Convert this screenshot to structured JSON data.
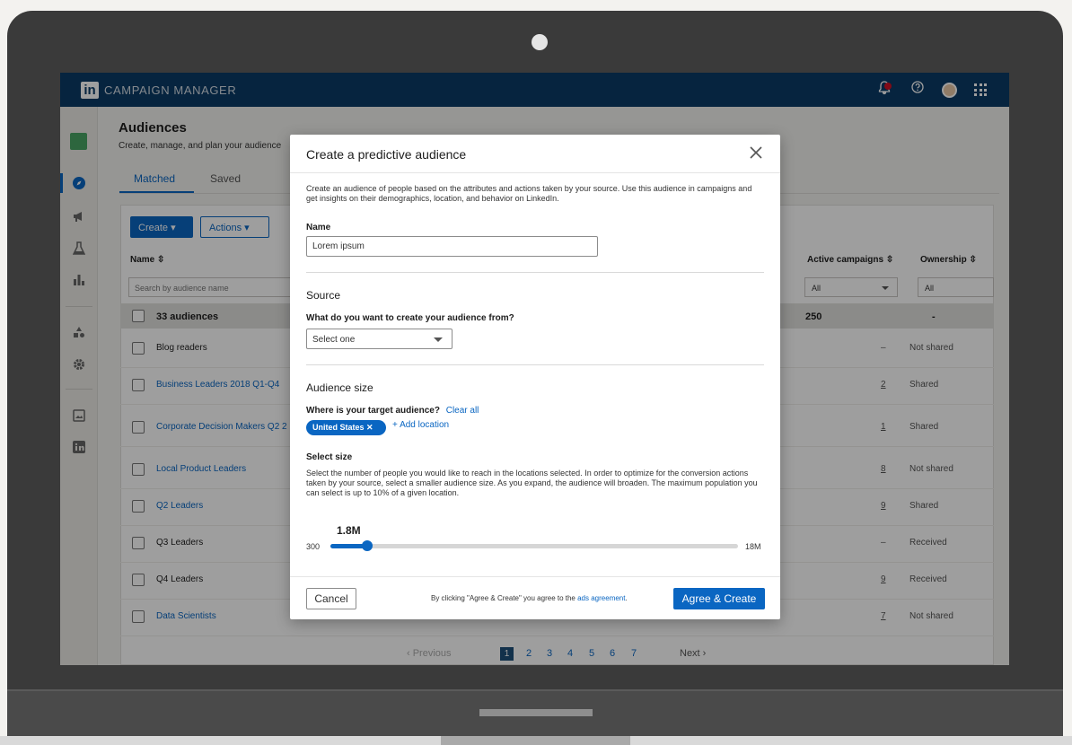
{
  "app": {
    "title": "CAMPAIGN MANAGER",
    "logo": "in"
  },
  "topbar": {
    "icons": [
      "bell-icon",
      "help-icon",
      "avatar",
      "apps-grid-icon"
    ]
  },
  "page": {
    "title": "Audiences",
    "subtitle": "Create, manage, and plan your audience",
    "tabs": [
      {
        "label": "Matched"
      },
      {
        "label": "Saved"
      }
    ]
  },
  "toolbar": {
    "create_label": "Create ▾",
    "actions_label": "Actions ▾"
  },
  "table": {
    "columns": {
      "name": "Name ⇳",
      "active": "Active campaigns ⇳",
      "ownership": "Ownership ⇳"
    },
    "search_placeholder": "Search by audience name",
    "filter_active": "All",
    "filter_ownership": "All",
    "summary": {
      "label": "33 audiences",
      "count": "250",
      "ownership": "-"
    },
    "rows": [
      {
        "name": "Blog readers",
        "count": "–",
        "ownership": "Not shared",
        "link": false
      },
      {
        "name": "Business Leaders 2018 Q1-Q4",
        "count": "2",
        "ownership": "Shared",
        "link": true
      },
      {
        "name": "Corporate Decision Makers Q2 2",
        "count": "1",
        "ownership": "Shared",
        "link": true
      },
      {
        "name": "Local Product Leaders",
        "count": "8",
        "ownership": "Not shared",
        "link": true
      },
      {
        "name": "Q2 Leaders",
        "count": "9",
        "ownership": "Shared",
        "link": true
      },
      {
        "name": "Q3 Leaders",
        "count": "–",
        "ownership": "Received",
        "link": false
      },
      {
        "name": "Q4 Leaders",
        "count": "9",
        "ownership": "Received",
        "link": false
      },
      {
        "name": "Data Scientists",
        "count": "7",
        "ownership": "Not shared",
        "link": true
      }
    ]
  },
  "pagination": {
    "previous": "‹ Previous",
    "pages": [
      "1",
      "2",
      "3",
      "4",
      "5",
      "6",
      "7"
    ],
    "next": "Next ›"
  },
  "modal": {
    "title": "Create a predictive audience",
    "description": "Create an audience of people based on the attributes and actions taken by your source. Use this audience in campaigns and get insights on their demographics, location, and behavior on LinkedIn.",
    "name_label": "Name",
    "name_value": "Lorem ipsum",
    "source_heading": "Source",
    "source_question": "What do you want to create your audience from?",
    "source_select": "Select one",
    "size_heading": "Audience size",
    "target_question": "Where is your target audience?",
    "clear_all": "Clear all",
    "location_chip": "United States ✕",
    "add_location": "+ Add location",
    "select_size_label": "Select size",
    "size_description": "Select the number of people you would like to reach in the locations selected. In order to optimize for the conversion actions taken by your source, select a smaller audience size. As you expand, the audience will broaden. The maximum population you can select is up to 10% of a given location.",
    "slider": {
      "value": "1.8M",
      "min": "300",
      "max": "18M",
      "fraction": 0.09
    },
    "cancel": "Cancel",
    "agree_text": "By clicking \"Agree & Create\" you agree to the ",
    "agree_link": "ads agreement",
    "agree_period": ".",
    "agree_button": "Agree & Create"
  },
  "colors": {
    "brand_blue": "#0a66c2",
    "topbar": "#0a3b66",
    "notification": "#d11124"
  }
}
